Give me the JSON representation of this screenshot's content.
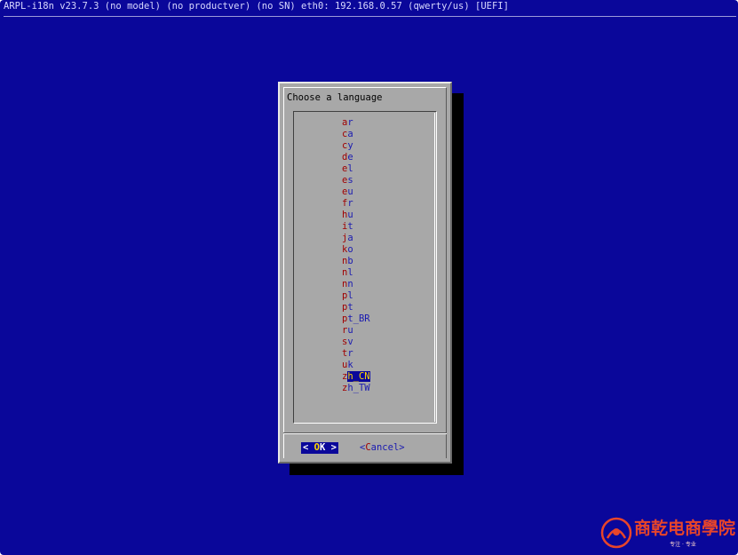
{
  "header": {
    "status_line": "ARPL-i18n v23.7.3 (no model) (no productver) (no SN) eth0: 192.168.0.57 (qwerty/us) [UEFI]"
  },
  "dialog": {
    "title": "Choose a language",
    "items": [
      {
        "first": "a",
        "rest": "r"
      },
      {
        "first": "c",
        "rest": "a"
      },
      {
        "first": "c",
        "rest": "y"
      },
      {
        "first": "d",
        "rest": "e"
      },
      {
        "first": "e",
        "rest": "l"
      },
      {
        "first": "e",
        "rest": "s"
      },
      {
        "first": "e",
        "rest": "u"
      },
      {
        "first": "f",
        "rest": "r"
      },
      {
        "first": "h",
        "rest": "u"
      },
      {
        "first": "i",
        "rest": "t"
      },
      {
        "first": "j",
        "rest": "a"
      },
      {
        "first": "k",
        "rest": "o"
      },
      {
        "first": "n",
        "rest": "b"
      },
      {
        "first": "n",
        "rest": "l"
      },
      {
        "first": "n",
        "rest": "n"
      },
      {
        "first": "p",
        "rest": "l"
      },
      {
        "first": "p",
        "rest": "t"
      },
      {
        "first": "p",
        "rest": "t_BR"
      },
      {
        "first": "r",
        "rest": "u"
      },
      {
        "first": "s",
        "rest": "v"
      },
      {
        "first": "t",
        "rest": "r"
      },
      {
        "first": "u",
        "rest": "k"
      },
      {
        "first": "z",
        "rest": "h_CN",
        "selected": true
      },
      {
        "first": "z",
        "rest": "h_TW"
      }
    ],
    "ok_button": {
      "left": "< ",
      "hot": "O",
      "rest": "K",
      "right": " >"
    },
    "cancel_button": {
      "left": "<",
      "hot": "C",
      "rest": "ancel",
      "right": ">"
    }
  },
  "watermark": {
    "text": "商乾电商學院",
    "sub": "专注 · 专业"
  },
  "colors": {
    "background": "#0a079a",
    "dialog": "#a8a8a8",
    "hotkey": "#a00000",
    "item_text": "#1a1ab0",
    "selected_text": "#ffd800"
  }
}
